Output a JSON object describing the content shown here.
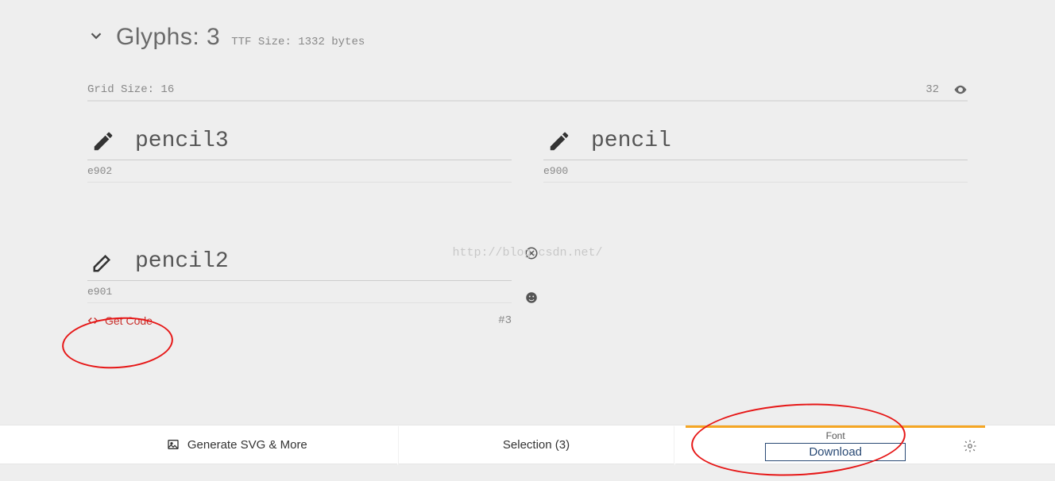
{
  "header": {
    "title": "Glyphs: 3",
    "ttf_size": "TTF Size: 1332 bytes"
  },
  "grid": {
    "left_label": "Grid Size: 16",
    "right_value": "32"
  },
  "glyphs": [
    {
      "name": "pencil3",
      "code": "e902",
      "icon": "pencil-icon"
    },
    {
      "name": "pencil",
      "code": "e900",
      "icon": "pencil-icon"
    },
    {
      "name": "pencil2",
      "code": "e901",
      "icon": "pencil-outline-icon"
    }
  ],
  "card_actions": {
    "get_code_label": "Get Code",
    "index_label": "#3"
  },
  "watermark": "http://blog.csdn.net/",
  "bottom_tabs": {
    "svg_label": "Generate SVG & More",
    "selection_label": "Selection (3)",
    "font_label": "Font",
    "download_label": "Download"
  }
}
